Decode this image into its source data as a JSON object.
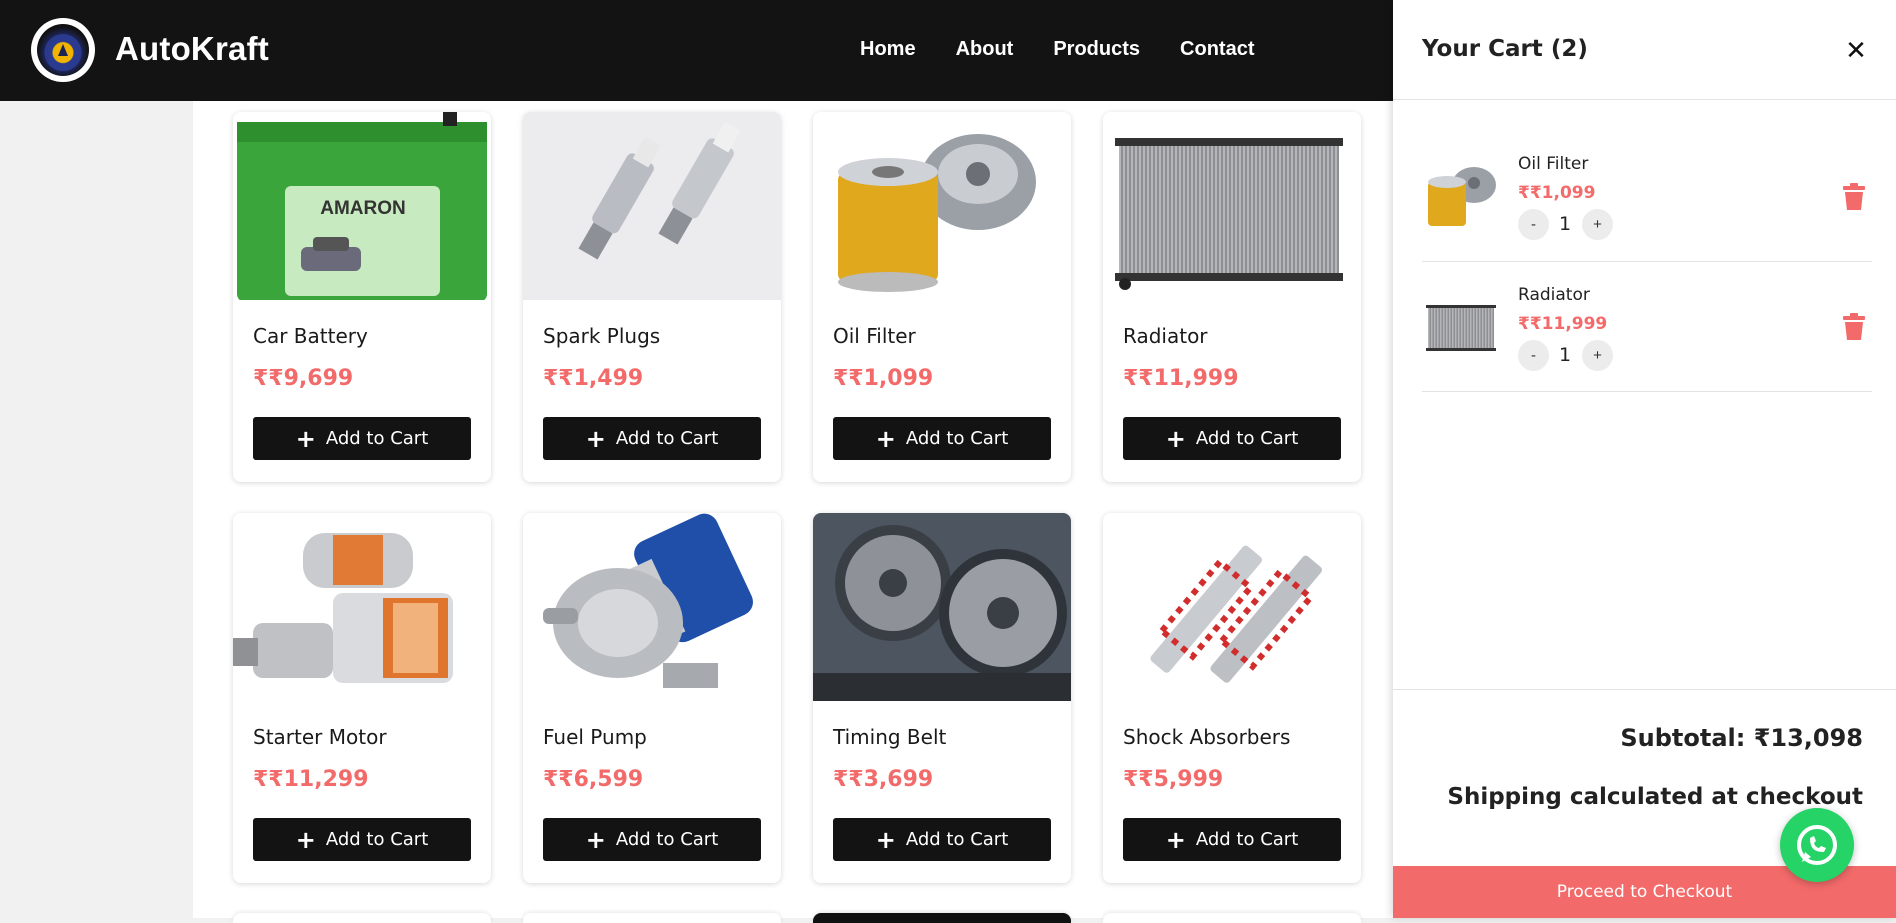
{
  "brand": {
    "name": "AutoKraft"
  },
  "nav": {
    "links": [
      "Home",
      "About",
      "Products",
      "Contact"
    ]
  },
  "products": [
    {
      "name": "Car Battery",
      "price": "₹₹9,699",
      "image": "car-battery-image"
    },
    {
      "name": "Spark Plugs",
      "price": "₹₹1,499",
      "image": "spark-plugs-image"
    },
    {
      "name": "Oil Filter",
      "price": "₹₹1,099",
      "image": "oil-filter-image"
    },
    {
      "name": "Radiator",
      "price": "₹₹11,999",
      "image": "radiator-image"
    },
    {
      "name": "Starter Motor",
      "price": "₹₹11,299",
      "image": "starter-motor-image"
    },
    {
      "name": "Fuel Pump",
      "price": "₹₹6,599",
      "image": "fuel-pump-image"
    },
    {
      "name": "Timing Belt",
      "price": "₹₹3,699",
      "image": "timing-belt-image"
    },
    {
      "name": "Shock Absorbers",
      "price": "₹₹5,999",
      "image": "shock-absorbers-image"
    }
  ],
  "add_to_cart_label": "Add to Cart",
  "cart": {
    "title": "Your Cart (2)",
    "items": [
      {
        "name": "Oil Filter",
        "price": "₹₹1,099",
        "qty": "1"
      },
      {
        "name": "Radiator",
        "price": "₹₹11,999",
        "qty": "1"
      }
    ],
    "qty_decrement": "-",
    "qty_increment": "+",
    "subtotal": "Subtotal: ₹13,098",
    "shipping_note": "Shipping calculated at checkout",
    "checkout_label": "Proceed to Checkout"
  },
  "colors": {
    "accent": "#f36a6a",
    "navbar": "#131313",
    "whatsapp": "#25d366"
  },
  "icons": [
    "close-icon",
    "trash-icon",
    "plus-icon",
    "whatsapp-icon"
  ]
}
